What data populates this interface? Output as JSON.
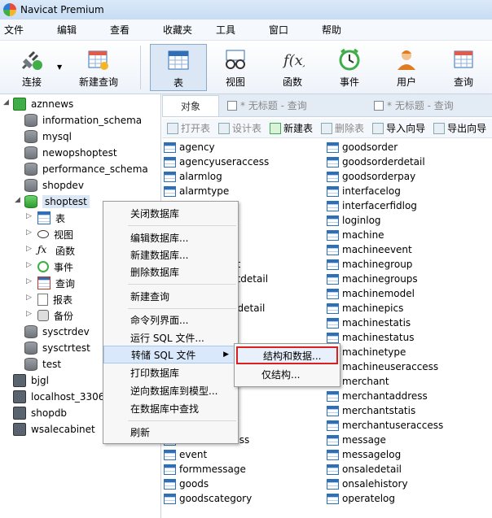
{
  "app": {
    "title": "Navicat Premium"
  },
  "menu": [
    "文件",
    "编辑",
    "查看",
    "收藏夹",
    "工具",
    "窗口",
    "帮助"
  ],
  "toolbar": {
    "connect": "连接",
    "new_query": "新建查询",
    "table": "表",
    "view": "视图",
    "function": "函数",
    "event": "事件",
    "user": "用户",
    "query": "查询"
  },
  "tree": {
    "connections": [
      {
        "name": "aznnews"
      },
      {
        "name": "bjgl"
      },
      {
        "name": "localhost_3306"
      },
      {
        "name": "shopdb"
      },
      {
        "name": "wsalecabinet"
      }
    ],
    "databases_top": [
      "information_schema",
      "mysql",
      "newopshoptest",
      "performance_schema",
      "shopdev"
    ],
    "selected_db": "shoptest",
    "children": [
      "表",
      "视图",
      "函数",
      "事件",
      "查询",
      "报表",
      "备份"
    ],
    "databases_bottom": [
      "sysctrdev",
      "sysctrtest",
      "test"
    ]
  },
  "tabs": {
    "objects": "对象",
    "untitled1": "* 无标题 - 查询",
    "untitled2": "* 无标题 - 查询"
  },
  "subtoolbar": {
    "open_table": "打开表",
    "design_table": "设计表",
    "new_table": "新建表",
    "delete_table": "删除表",
    "import_wizard": "导入向导",
    "export_wizard": "导出向导"
  },
  "tables_col1": [
    "agency",
    "agencyuseraccess",
    "alarmlog",
    "alarmtype",
    "",
    "access",
    "",
    "ss",
    "nessaccount",
    "nessaccountdetail",
    "ormaccount",
    "ormaccountdetail",
    "ybill",
    "ybilldetail",
    "",
    "",
    "",
    "t",
    "",
    "ogs",
    "antuseraccess",
    "event",
    "formmessage",
    "goods",
    "goodscategory"
  ],
  "tables_col2": [
    "goodsorder",
    "goodsorderdetail",
    "goodsorderpay",
    "interfacelog",
    "interfacerfidlog",
    "loginlog",
    "machine",
    "machineevent",
    "machinegroup",
    "machinegroups",
    "machinemodel",
    "machinepics",
    "machinestatis",
    "machinestatus",
    "machinetype",
    "machineuseraccess",
    "merchant",
    "merchantaddress",
    "merchantstatis",
    "merchantuseraccess",
    "message",
    "messagelog",
    "onsaledetail",
    "onsalehistory",
    "operatelog"
  ],
  "context_menu": {
    "close_db": "关闭数据库",
    "edit_db": "编辑数据库...",
    "new_db": "新建数据库...",
    "delete_db": "删除数据库",
    "new_query": "新建查询",
    "console": "命令列界面...",
    "run_sql": "运行 SQL 文件...",
    "dump_sql": "转储 SQL 文件",
    "print_db": "打印数据库",
    "reverse_model": "逆向数据库到模型...",
    "find_in_db": "在数据库中查找",
    "refresh": "刷新"
  },
  "submenu": {
    "structure_data": "结构和数据...",
    "structure_only": "仅结构..."
  }
}
